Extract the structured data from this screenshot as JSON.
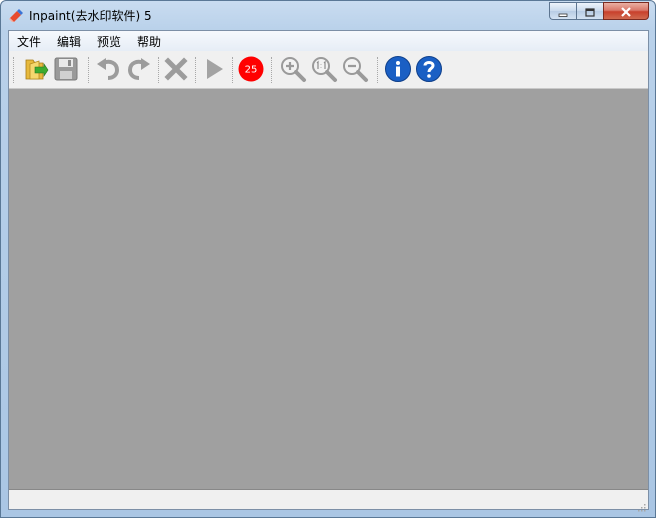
{
  "window": {
    "title": "Inpaint(去水印软件) 5",
    "app_icon": "eraser-icon"
  },
  "caption_buttons": [
    {
      "name": "minimize",
      "icon": "minimize-icon"
    },
    {
      "name": "maximize",
      "icon": "restore-icon"
    },
    {
      "name": "close",
      "icon": "close-icon"
    }
  ],
  "menu": {
    "items": [
      "文件",
      "编辑",
      "预览",
      "帮助"
    ]
  },
  "toolbar": {
    "open": "folder-open-icon",
    "save": "save-disk-icon",
    "undo": "undo-icon",
    "redo": "redo-icon",
    "delete": "delete-x-icon",
    "run": "play-icon",
    "counter_value": "25",
    "counter_color": "#ff0000",
    "zoom_in": "zoom-in-icon",
    "zoom_actual": "zoom-1to1-icon",
    "zoom_out": "zoom-out-icon",
    "info": "info-icon",
    "help": "help-icon"
  },
  "colors": {
    "canvas": "#a0a0a0",
    "accent_blue": "#1a5fc4"
  }
}
